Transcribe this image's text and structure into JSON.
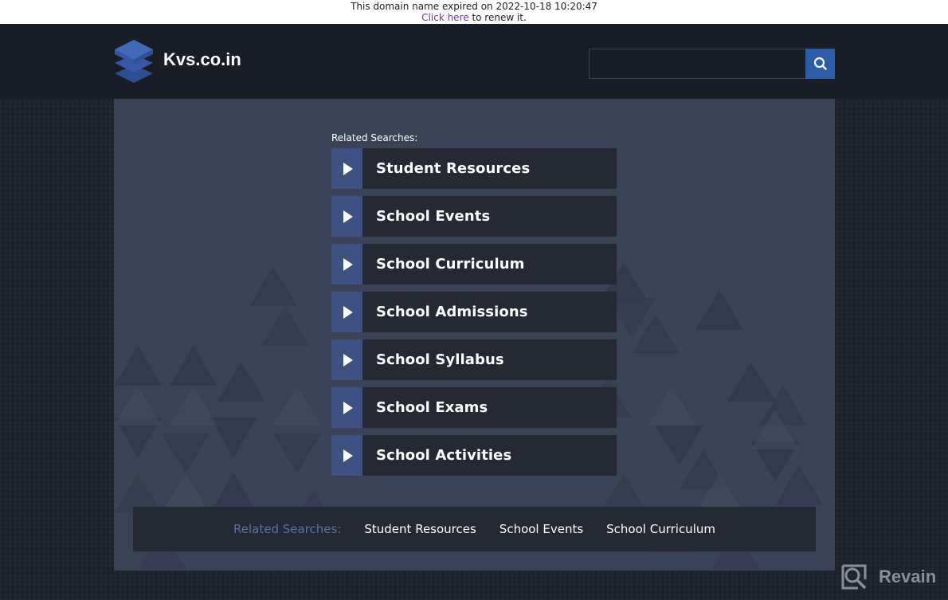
{
  "expiry_notice": {
    "message": "This domain name expired on 2022-10-18 10:20:47",
    "link_text": "Click here",
    "suffix": " to renew it."
  },
  "header": {
    "logo_text": "Kvs.co.in",
    "logo_icon": "layers-icon",
    "search": {
      "value": "",
      "placeholder": "",
      "button_icon": "search-icon"
    }
  },
  "main": {
    "related_label": "Related Searches:",
    "links": [
      {
        "label": "Student Resources"
      },
      {
        "label": "School Events"
      },
      {
        "label": "School Curriculum"
      },
      {
        "label": "School Admissions"
      },
      {
        "label": "School Syllabus"
      },
      {
        "label": "School Exams"
      },
      {
        "label": "School Activities"
      }
    ]
  },
  "footer": {
    "label": "Related Searches:",
    "links": [
      {
        "label": "Student Resources"
      },
      {
        "label": "School Events"
      },
      {
        "label": "School Curriculum"
      }
    ]
  },
  "watermark": {
    "text": "Revain"
  },
  "colors": {
    "accent": "#2c5ba8",
    "arrow_block": "#3d5282",
    "link_bg": "#242933",
    "panel_bg": "#3a4256",
    "header_bg": "#181d26",
    "footer_label": "#5b7399"
  }
}
